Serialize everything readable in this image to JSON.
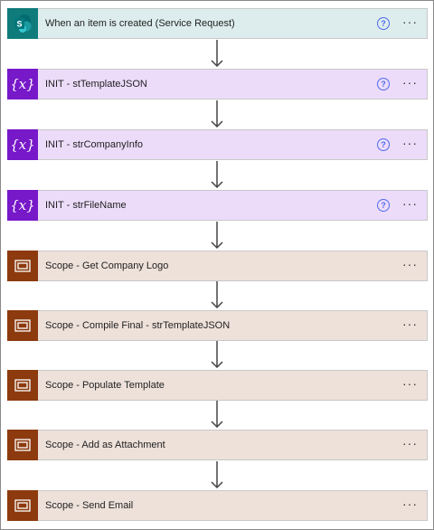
{
  "flow": {
    "steps": [
      {
        "label": "When an item is created (Service Request)",
        "kind": "trigger",
        "icon": "sharepoint-icon",
        "has_help": true
      },
      {
        "label": "INIT - stTemplateJSON",
        "kind": "variable",
        "icon": "variable-icon",
        "has_help": true
      },
      {
        "label": "INIT - strCompanyInfo",
        "kind": "variable",
        "icon": "variable-icon",
        "has_help": true
      },
      {
        "label": "INIT - strFileName",
        "kind": "variable",
        "icon": "variable-icon",
        "has_help": true
      },
      {
        "label": "Scope - Get Company Logo",
        "kind": "scope",
        "icon": "scope-icon",
        "has_help": false
      },
      {
        "label": "Scope - Compile Final - strTemplateJSON",
        "kind": "scope",
        "icon": "scope-icon",
        "has_help": false
      },
      {
        "label": "Scope - Populate Template",
        "kind": "scope",
        "icon": "scope-icon",
        "has_help": false
      },
      {
        "label": "Scope - Add as Attachment",
        "kind": "scope",
        "icon": "scope-icon",
        "has_help": false
      },
      {
        "label": "Scope - Send Email",
        "kind": "scope",
        "icon": "scope-icon",
        "has_help": false
      }
    ],
    "help_glyph": "?",
    "more_glyph": "···",
    "variable_glyph": "{x}",
    "sharepoint_glyph": "S",
    "colors": {
      "trigger_bg": "#ddeded",
      "trigger_icon": "#0f7b7b",
      "variable_bg": "#ecdcfa",
      "variable_icon": "#7718c9",
      "scope_bg": "#eee1da",
      "scope_icon": "#8c3a0e",
      "help_blue": "#4f6bed"
    }
  }
}
